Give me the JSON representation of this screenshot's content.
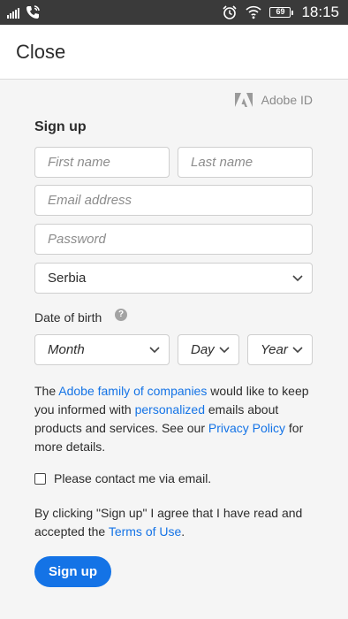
{
  "status_bar": {
    "time": "18:15",
    "battery": "69",
    "icons": [
      "signal-icon",
      "phone-call-icon",
      "alarm-icon",
      "wifi-icon",
      "battery-icon"
    ]
  },
  "header": {
    "close_label": "Close"
  },
  "brand": {
    "adobe_id_label": "Adobe ID",
    "logo_icon": "adobe-logo-icon"
  },
  "form": {
    "heading": "Sign up",
    "first_name_placeholder": "First name",
    "last_name_placeholder": "Last name",
    "email_placeholder": "Email address",
    "password_placeholder": "Password",
    "country_value": "Serbia",
    "dob_label": "Date of birth",
    "dob_help_glyph": "?",
    "month_placeholder": "Month",
    "day_placeholder": "Day",
    "year_placeholder": "Year",
    "notice": {
      "part1": "The ",
      "link1": "Adobe family of companies",
      "part2": " would like to keep you informed with ",
      "link2": "personalized",
      "part3": " emails about products and services. See our ",
      "link3": "Privacy Policy",
      "part4": " for more details."
    },
    "contact_checkbox_label": "Please contact me via email.",
    "contact_checked": false,
    "terms": {
      "part1": "By clicking \"Sign up\" I agree that I have read and accepted the ",
      "link": "Terms of Use",
      "part2": "."
    },
    "submit_label": "Sign up"
  },
  "colors": {
    "accent": "#1473e6",
    "status_bar": "#3a3a3a",
    "background": "#f5f5f5",
    "text": "#2c2c2c",
    "placeholder": "#8d8d8d"
  }
}
